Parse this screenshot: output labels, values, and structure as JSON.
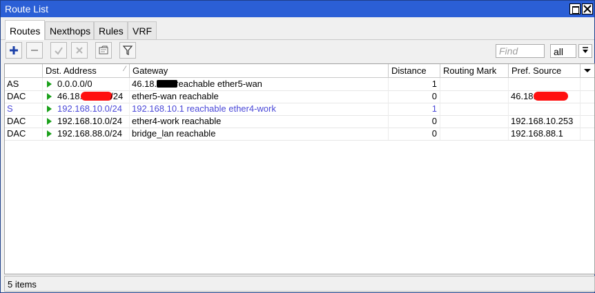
{
  "window": {
    "title": "Route List"
  },
  "tabs": [
    {
      "label": "Routes",
      "active": true
    },
    {
      "label": "Nexthops",
      "active": false
    },
    {
      "label": "Rules",
      "active": false
    },
    {
      "label": "VRF",
      "active": false
    }
  ],
  "toolbar": {
    "buttons": [
      "add-icon",
      "remove-icon",
      "enable-icon",
      "disable-icon",
      "comment-icon",
      "filter-icon"
    ],
    "find_placeholder": "Find",
    "filter_select": "all"
  },
  "table": {
    "columns": [
      "",
      "Dst. Address",
      "Gateway",
      "Distance",
      "Routing Mark",
      "Pref. Source"
    ],
    "rows": [
      {
        "flags": "AS",
        "dst_pre": "0.0.0.0/0",
        "dst_post": "",
        "gw_pre": "46.18.",
        "gw_post": "reachable ether5-wan",
        "distance": "1",
        "mark": "",
        "src_pre": "",
        "style": "normal"
      },
      {
        "flags": "DAC",
        "dst_pre": "46.18.",
        "dst_post": "/24",
        "gw_pre": "ether5-wan reachable",
        "gw_post": "",
        "distance": "0",
        "mark": "",
        "src_pre": "46.18.",
        "style": "normal"
      },
      {
        "flags": "S",
        "dst_pre": "192.168.10.0/24",
        "dst_post": "",
        "gw_pre": "192.168.10.1 reachable ether4-work",
        "gw_post": "",
        "distance": "1",
        "mark": "",
        "src_pre": "",
        "style": "blue"
      },
      {
        "flags": "DAC",
        "dst_pre": "192.168.10.0/24",
        "dst_post": "",
        "gw_pre": "ether4-work reachable",
        "gw_post": "",
        "distance": "0",
        "mark": "",
        "src_pre": "192.168.10.253",
        "style": "normal"
      },
      {
        "flags": "DAC",
        "dst_pre": "192.168.88.0/24",
        "dst_post": "",
        "gw_pre": "bridge_lan reachable",
        "gw_post": "",
        "distance": "0",
        "mark": "",
        "src_pre": "192.168.88.1",
        "style": "normal"
      }
    ]
  },
  "status": {
    "text": "5 items"
  },
  "colors": {
    "titlebar": "#2b5fd6",
    "static_route_text": "#4a48d8",
    "active_flag": "#1aa01a",
    "redaction_red": "#ff1010"
  }
}
